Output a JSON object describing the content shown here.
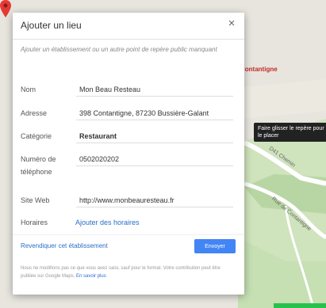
{
  "map": {
    "place_label": "Contantigne",
    "road_label_1": "D41 Chemin",
    "road_label_2": "Rue de Contantigne",
    "tooltip": "Faire glisser le repère pour le placer"
  },
  "dialog": {
    "title": "Ajouter un lieu",
    "close_icon": "×",
    "description": "Ajouter un établissement ou un autre point de repère public manquant",
    "fields": {
      "name": {
        "label": "Nom",
        "value": "Mon Beau Resteau"
      },
      "address": {
        "label": "Adresse",
        "value": "398 Contantigne, 87230 Bussière-Galant"
      },
      "category": {
        "label": "Catégorie",
        "value": "Restaurant"
      },
      "phone": {
        "label_line1": "Numéro de",
        "label_line2": "téléphone",
        "value": "0502020202"
      },
      "website": {
        "label": "Site Web",
        "value": "http://www.monbeauresteau.fr"
      },
      "hours": {
        "label": "Horaires",
        "link": "Ajouter des horaires"
      }
    },
    "claim_link": "Revendiquer cet établissement",
    "submit_label": "Envoyer",
    "footnote_text": "Nous ne modifions pas ce que vous avez saisi, sauf pour le format. Votre contribution peut être publiée sur Google Maps.",
    "footnote_link": "En savoir plus"
  },
  "colors": {
    "accent": "#4285f4",
    "link": "#2a6ec9",
    "pin": "#e53935",
    "map_green": "#c8dfb6"
  }
}
